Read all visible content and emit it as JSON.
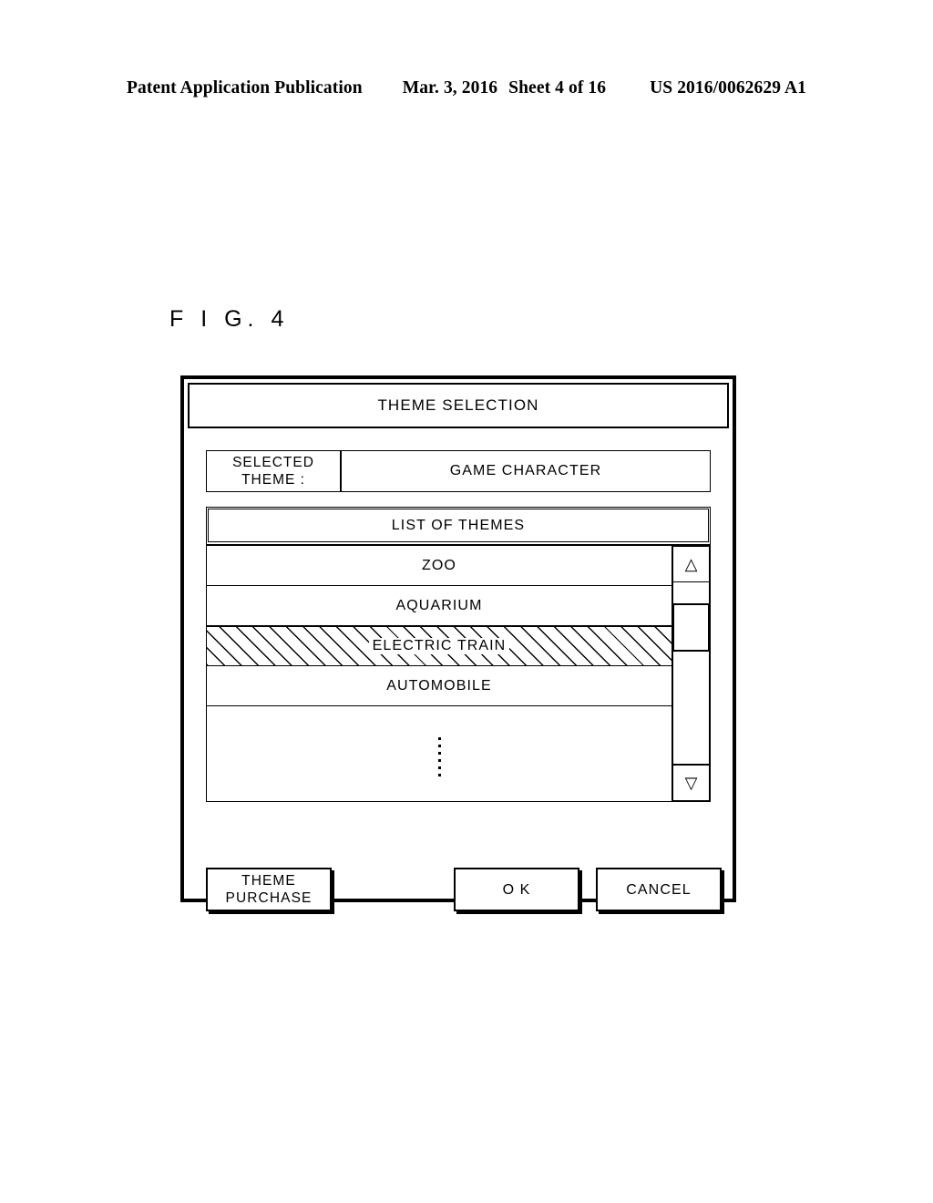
{
  "patent_header": {
    "publication": "Patent Application Publication",
    "date": "Mar. 3, 2016",
    "sheet": "Sheet 4 of 16",
    "number": "US 2016/0062629 A1"
  },
  "figure": {
    "label": "F I G.  4"
  },
  "dialog": {
    "title": "THEME SELECTION",
    "selected_theme": {
      "label_line1": "SELECTED",
      "label_line2": "THEME :",
      "value": "GAME CHARACTER"
    },
    "list": {
      "header": "LIST OF THEMES",
      "items": [
        {
          "label": "ZOO",
          "selected": false
        },
        {
          "label": "AQUARIUM",
          "selected": false
        },
        {
          "label": "ELECTRIC TRAIN",
          "selected": true
        },
        {
          "label": "AUTOMOBILE",
          "selected": false
        }
      ],
      "overflow_indicator": "vertical-ellipsis",
      "scrollbar": {
        "up_arrow": "△",
        "down_arrow": "▽"
      }
    },
    "buttons": {
      "purchase_line1": "THEME",
      "purchase_line2": "PURCHASE",
      "ok": "O K",
      "cancel": "CANCEL"
    }
  }
}
